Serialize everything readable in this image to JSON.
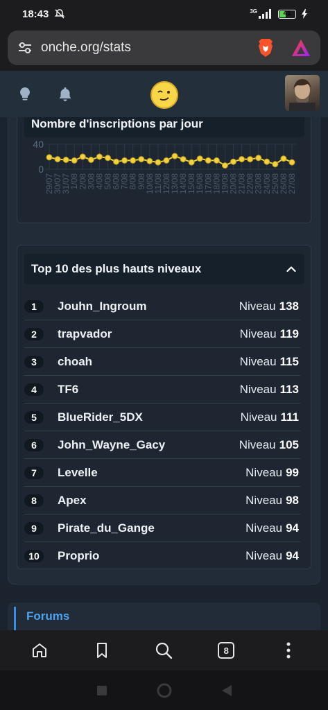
{
  "status_bar": {
    "time": "18:43",
    "network": "3G",
    "battery": "41",
    "battery_level": 0.41
  },
  "browser": {
    "url": "onche.org/stats",
    "tab_count": "8"
  },
  "colors": {
    "accent": "#4ca3f0",
    "chart_line": "#f2d23f",
    "smiley": "#f7d64a"
  },
  "chart": {
    "title": "Nombre d'inscriptions par jour",
    "chart_data": {
      "type": "line",
      "title": "Nombre d'inscriptions par jour",
      "y_ticks": [
        "40",
        "0"
      ],
      "ylim": [
        0,
        40
      ],
      "x": [
        "29/07",
        "30/07",
        "31/07",
        "1/08",
        "2/08",
        "3/08",
        "4/08",
        "5/08",
        "6/08",
        "7/08",
        "8/08",
        "9/08",
        "10/08",
        "11/08",
        "12/08",
        "13/08",
        "14/08",
        "15/08",
        "16/08",
        "17/08",
        "18/08",
        "19/08",
        "20/08",
        "21/08",
        "22/08",
        "23/08",
        "24/08",
        "25/08",
        "26/08",
        "27/08"
      ],
      "y": [
        19,
        16,
        15,
        14,
        20,
        15,
        20,
        18,
        12,
        14,
        14,
        16,
        13,
        11,
        14,
        21,
        16,
        11,
        17,
        14,
        14,
        6,
        12,
        16,
        16,
        18,
        12,
        8,
        17,
        11
      ],
      "grid": true
    }
  },
  "top_levels": {
    "title": "Top 10 des plus hauts niveaux",
    "level_label": "Niveau",
    "rows": [
      {
        "rank": "1",
        "name": "Jouhn_Ingroum",
        "level": "138"
      },
      {
        "rank": "2",
        "name": "trapvador",
        "level": "119"
      },
      {
        "rank": "3",
        "name": "choah",
        "level": "115"
      },
      {
        "rank": "4",
        "name": "TF6",
        "level": "113"
      },
      {
        "rank": "5",
        "name": "BlueRider_5DX",
        "level": "111"
      },
      {
        "rank": "6",
        "name": "John_Wayne_Gacy",
        "level": "105"
      },
      {
        "rank": "7",
        "name": "Levelle",
        "level": "99"
      },
      {
        "rank": "8",
        "name": "Apex",
        "level": "98"
      },
      {
        "rank": "9",
        "name": "Pirate_du_Gange",
        "level": "94"
      },
      {
        "rank": "10",
        "name": "Proprio",
        "level": "94"
      }
    ]
  },
  "forums": {
    "label": "Forums"
  },
  "icons": {
    "status": [
      "mute-icon",
      "signal-icon",
      "battery-icon",
      "charging-icon"
    ],
    "browser": [
      "site-settings-icon",
      "brave-shields-icon",
      "brave-rewards-icon"
    ],
    "header": [
      "lightbulb-icon",
      "bell-icon",
      "smiley-logo-icon",
      "user-avatar"
    ],
    "nav": [
      "home-icon",
      "bookmark-icon",
      "search-icon",
      "tabs-icon",
      "menu-dots-icon"
    ],
    "system": [
      "recent-apps-icon",
      "home-circle-icon",
      "back-icon"
    ]
  }
}
